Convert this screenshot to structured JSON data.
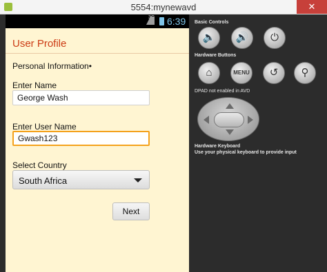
{
  "window": {
    "title": "5554:mynewavd",
    "close_label": "✕"
  },
  "status_bar": {
    "network": "3G",
    "time": "6:39"
  },
  "form": {
    "title": "User Profile",
    "section_label": "Personal Information•",
    "name_label": "Enter Name",
    "name_value": "George Wash",
    "username_label": "Enter User Name",
    "username_value": "Gwash123",
    "country_label": "Select Country",
    "country_value": "South Africa",
    "next_label": "Next"
  },
  "controls": {
    "basic_heading": "Basic Controls",
    "hardware_heading": "Hardware Buttons",
    "menu_label": "MENU",
    "dpad_note": "DPAD not enabled in AVD",
    "keyboard_heading": "Hardware Keyboard",
    "keyboard_note": "Use your physical keyboard to provide input"
  },
  "colors": {
    "screen_background": "#fff5d2",
    "title_accent": "#cc3b14",
    "focus_border": "#f4a11b",
    "frame": "#2c2c2c",
    "close_button": "#c7403a"
  },
  "icons": {
    "volume_down": "speaker-icon",
    "volume_up": "speaker-loud-icon",
    "power": "power-icon",
    "home": "home-icon",
    "back": "back-arrow-icon",
    "search": "search-icon"
  }
}
